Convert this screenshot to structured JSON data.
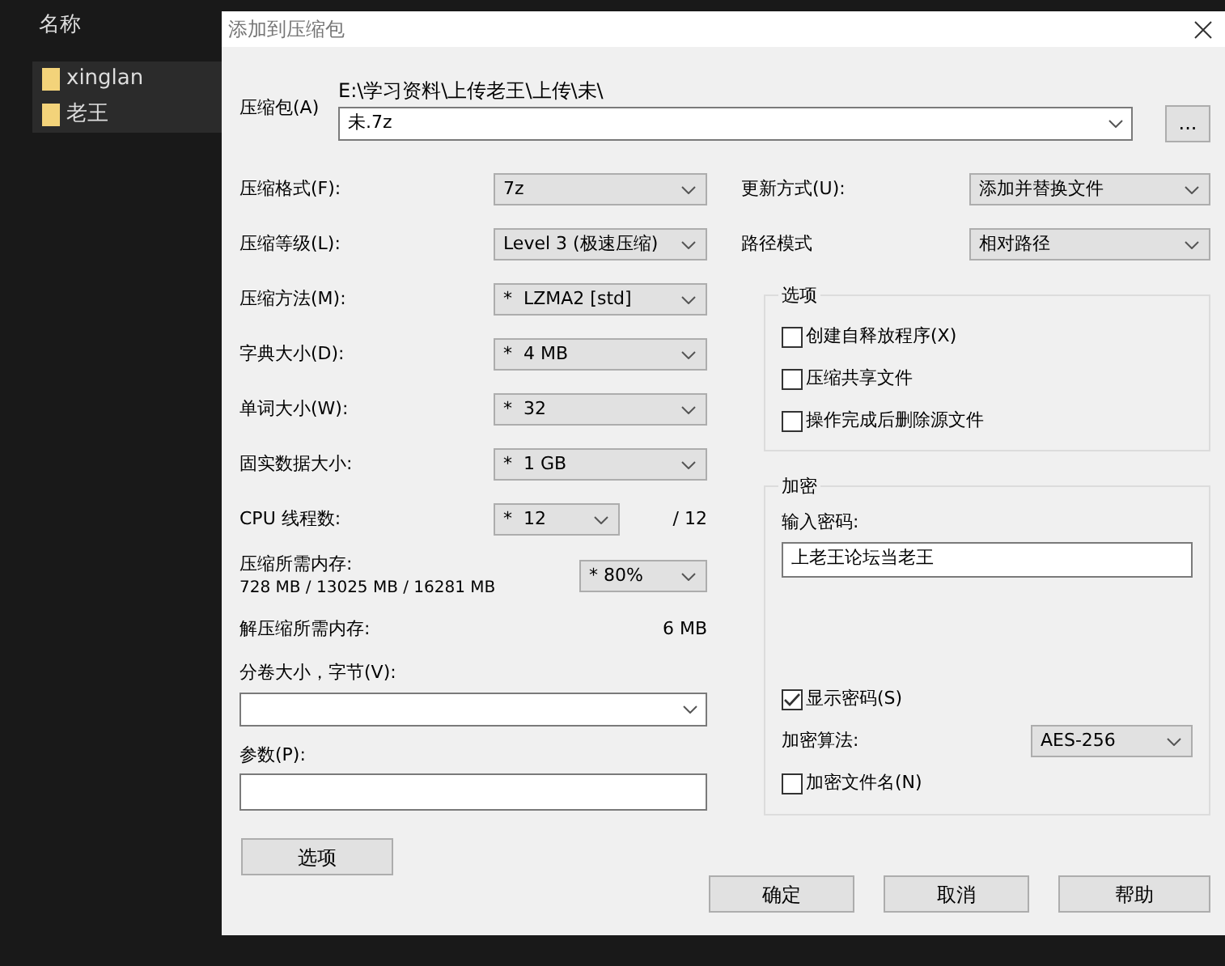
{
  "explorer": {
    "column_header": "名称",
    "items": [
      {
        "name": "xinglan"
      },
      {
        "name": "老王"
      }
    ]
  },
  "dialog": {
    "title": "添加到压缩包",
    "archive": {
      "label": "压缩包(A)",
      "path": "E:\\学习资料\\上传老王\\上传\\未\\",
      "filename": "未.7z",
      "browse_button": "..."
    },
    "settings": [
      {
        "kind": "select",
        "label": "压缩格式(F):",
        "value": "7z"
      },
      {
        "kind": "select",
        "label": "压缩等级(L):",
        "value": "Level 3 (极速压缩)"
      },
      {
        "kind": "select",
        "label": "压缩方法(M):",
        "value": "*  LZMA2 [std]"
      },
      {
        "kind": "select",
        "label": "字典大小(D):",
        "value": "*  4 MB"
      },
      {
        "kind": "select",
        "label": "单词大小(W):",
        "value": "*  32"
      },
      {
        "kind": "select",
        "label": "固实数据大小:",
        "value": "*  1 GB"
      },
      {
        "kind": "threads",
        "label": "CPU 线程数:",
        "value": "*  12",
        "total": "/ 12"
      },
      {
        "kind": "memory",
        "label": "压缩所需内存:",
        "detail": "728 MB / 13025 MB / 16281 MB",
        "value": "* 80%"
      },
      {
        "kind": "info",
        "label": "解压缩所需内存:",
        "value": "6 MB"
      }
    ],
    "volume": {
      "label": "分卷大小，字节(V):"
    },
    "parameters": {
      "label": "参数(P):"
    },
    "options_button": "选项",
    "update_mode": {
      "label": "更新方式(U):",
      "value": "添加并替换文件"
    },
    "path_mode": {
      "label": "路径模式",
      "value": "相对路径"
    },
    "options_group": {
      "title": "选项",
      "checkboxes": [
        {
          "label": "创建自释放程序(X)",
          "checked": false
        },
        {
          "label": "压缩共享文件",
          "checked": false
        },
        {
          "label": "操作完成后删除源文件",
          "checked": false
        }
      ]
    },
    "encryption": {
      "title": "加密",
      "password_label": "输入密码:",
      "password": "上老王论坛当老王",
      "show_password": {
        "label": "显示密码(S)",
        "checked": true
      },
      "method_label": "加密算法:",
      "method": "AES-256",
      "encrypt_names": {
        "label": "加密文件名(N)",
        "checked": false
      }
    },
    "buttons": [
      "确定",
      "取消",
      "帮助"
    ]
  }
}
